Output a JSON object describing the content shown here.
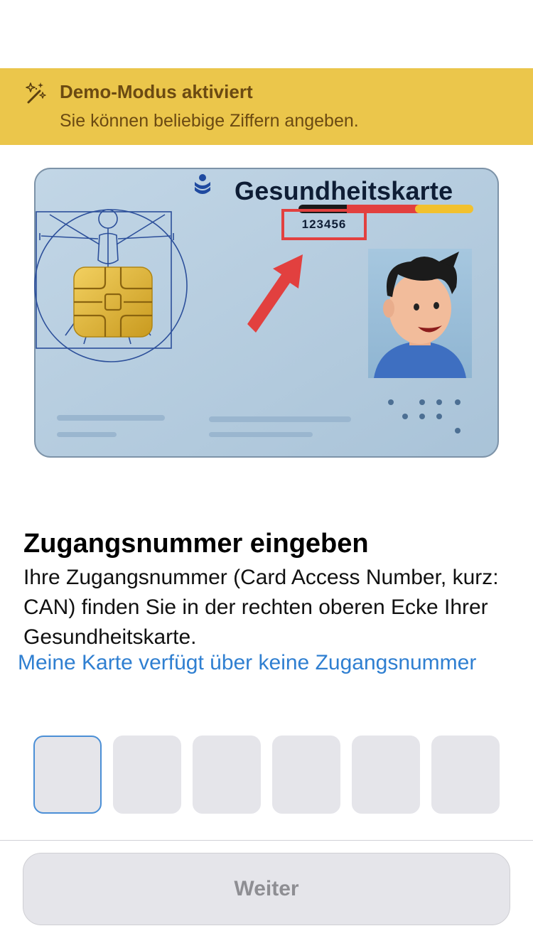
{
  "demo_banner": {
    "icon": "magic-wand-sparkles-icon",
    "title": "Demo-Modus aktiviert",
    "subtitle": "Sie können beliebige Ziffern angeben.",
    "color": "#ebc64b"
  },
  "card_illustration": {
    "title": "Gesundheitskarte",
    "can_number": "123456",
    "highlight_color": "#e2403f"
  },
  "main": {
    "heading": "Zugangsnummer eingeben",
    "body": "Ihre Zugangsnummer (Card Access Number, kurz: CAN) finden Sie in der rechten oberen Ecke Ihrer Gesundheitskarte.",
    "no_can_link": "Meine Karte verfügt über keine Zugangsnummer",
    "link_color": "#2f7fd1"
  },
  "pin_input": {
    "digit_count": 6,
    "values": [
      "",
      "",
      "",
      "",
      "",
      ""
    ],
    "active_index": 0
  },
  "footer": {
    "continue_label": "Weiter",
    "continue_enabled": false
  }
}
